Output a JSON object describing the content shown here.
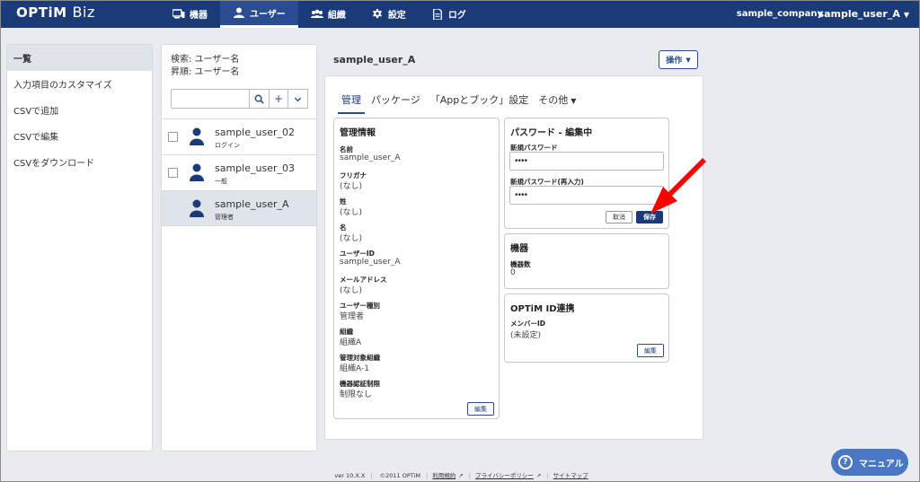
{
  "header": {
    "logo_main": "OPTiM",
    "logo_sub": "Biz",
    "nav": [
      {
        "label": "機器",
        "icon": "device-icon"
      },
      {
        "label": "ユーザー",
        "icon": "user-icon"
      },
      {
        "label": "組織",
        "icon": "organization-icon"
      },
      {
        "label": "設定",
        "icon": "gear-icon"
      },
      {
        "label": "ログ",
        "icon": "log-icon"
      }
    ],
    "active_nav": "ユーザー",
    "company": "sample_company",
    "user": "sample_user_A"
  },
  "sidebar": {
    "items": [
      {
        "label": "一覧",
        "active": true
      },
      {
        "label": "入力項目のカスタマイズ"
      },
      {
        "label": "CSVで追加"
      },
      {
        "label": "CSVで編集"
      },
      {
        "label": "CSVをダウンロード"
      }
    ]
  },
  "userlist": {
    "search_info": "検索: ユーザー名",
    "sort_info": "昇順: ユーザー名",
    "search_value": "",
    "users": [
      {
        "name": "sample_user_02",
        "role": "ログイン",
        "checkbox": true,
        "selected": false
      },
      {
        "name": "sample_user_03",
        "role": "一般",
        "checkbox": true,
        "selected": false
      },
      {
        "name": "sample_user_A",
        "role": "管理者",
        "checkbox": false,
        "selected": true
      }
    ]
  },
  "main": {
    "title": "sample_user_A",
    "ops_label": "操作",
    "tabs": [
      "管理",
      "パッケージ",
      "「Appとブック」設定",
      "その他"
    ],
    "active_tab": "管理",
    "mgmt": {
      "title": "管理情報",
      "fields": [
        {
          "label": "名前",
          "value": "sample_user_A"
        },
        {
          "label": "フリガナ",
          "value": "(なし)"
        },
        {
          "label": "姓",
          "value": "(なし)"
        },
        {
          "label": "名",
          "value": "(なし)"
        },
        {
          "label": "ユーザーID",
          "value": "sample_user_A"
        },
        {
          "label": "メールアドレス",
          "value": "(なし)"
        },
        {
          "label": "ユーザー種別",
          "value": "管理者"
        },
        {
          "label": "組織",
          "value": "組織A"
        },
        {
          "label": "管理対象組織",
          "value": "組織A-1"
        },
        {
          "label": "機器認証制限",
          "value": "制限なし"
        }
      ],
      "edit_label": "編集"
    },
    "password": {
      "title": "パスワード - 編集中",
      "new_label": "新規パスワード",
      "new_value": "••••",
      "confirm_label": "新規パスワード(再入力)",
      "confirm_value": "••••",
      "cancel_label": "取消",
      "save_label": "保存"
    },
    "devices": {
      "title": "機器",
      "count_label": "機器数",
      "count_value": "0"
    },
    "optim_id": {
      "title": "OPTiM ID連携",
      "member_label": "メンバーID",
      "member_value": "(未設定)",
      "edit_label": "編集"
    }
  },
  "footer": {
    "version": "ver 10.X.X",
    "copyright": "©2011 OPTiM",
    "terms": "利用規約",
    "privacy": "プライバシーポリシー",
    "sitemap": "サイトマップ"
  },
  "manual_label": "マニュアル",
  "colors": {
    "header": "#1a3a78",
    "accent": "#2a4d91",
    "arrow": "#ff0000",
    "manual": "#4a77c4"
  }
}
